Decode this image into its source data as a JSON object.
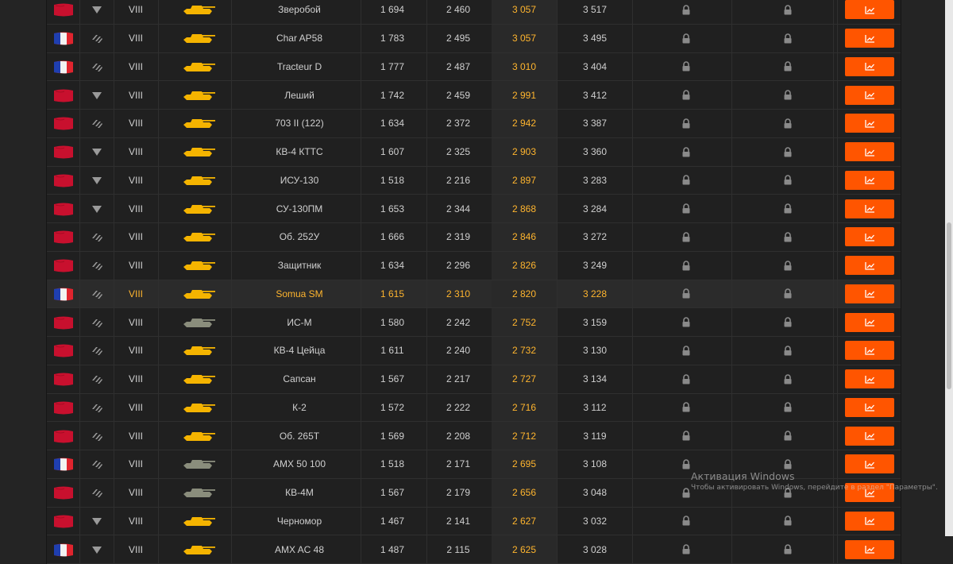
{
  "rows": [
    {
      "nation": "ussr",
      "type": "td",
      "tier": "VIII",
      "name": "Зверобой",
      "v1": "1 694",
      "v2": "2 460",
      "v3": "3 057",
      "v4": "3 517",
      "tank_color": "#f5b400"
    },
    {
      "nation": "france",
      "type": "med",
      "tier": "VIII",
      "name": "Char AP58",
      "v1": "1 783",
      "v2": "2 495",
      "v3": "3 057",
      "v4": "3 495",
      "tank_color": "#f5b400"
    },
    {
      "nation": "france",
      "type": "med",
      "tier": "VIII",
      "name": "Tracteur D",
      "v1": "1 777",
      "v2": "2 487",
      "v3": "3 010",
      "v4": "3 404",
      "tank_color": "#f5b400"
    },
    {
      "nation": "ussr",
      "type": "td",
      "tier": "VIII",
      "name": "Леший",
      "v1": "1 742",
      "v2": "2 459",
      "v3": "2 991",
      "v4": "3 412",
      "tank_color": "#f5b400"
    },
    {
      "nation": "ussr",
      "type": "med",
      "tier": "VIII",
      "name": "703 II (122)",
      "v1": "1 634",
      "v2": "2 372",
      "v3": "2 942",
      "v4": "3 387",
      "tank_color": "#f5b400"
    },
    {
      "nation": "ussr",
      "type": "td",
      "tier": "VIII",
      "name": "КВ-4 КТТС",
      "v1": "1 607",
      "v2": "2 325",
      "v3": "2 903",
      "v4": "3 360",
      "tank_color": "#f5b400"
    },
    {
      "nation": "ussr",
      "type": "td",
      "tier": "VIII",
      "name": "ИСУ-130",
      "v1": "1 518",
      "v2": "2 216",
      "v3": "2 897",
      "v4": "3 283",
      "tank_color": "#f5b400"
    },
    {
      "nation": "ussr",
      "type": "td",
      "tier": "VIII",
      "name": "СУ-130ПМ",
      "v1": "1 653",
      "v2": "2 344",
      "v3": "2 868",
      "v4": "3 284",
      "tank_color": "#f5b400"
    },
    {
      "nation": "ussr",
      "type": "med",
      "tier": "VIII",
      "name": "Об. 252У",
      "v1": "1 666",
      "v2": "2 319",
      "v3": "2 846",
      "v4": "3 272",
      "tank_color": "#f5b400"
    },
    {
      "nation": "ussr",
      "type": "med",
      "tier": "VIII",
      "name": "Защитник",
      "v1": "1 634",
      "v2": "2 296",
      "v3": "2 826",
      "v4": "3 249",
      "tank_color": "#f5b400"
    },
    {
      "nation": "france",
      "type": "med",
      "tier": "VIII",
      "name": "Somua SM",
      "v1": "1 615",
      "v2": "2 310",
      "v3": "2 820",
      "v4": "3 228",
      "tank_color": "#f5b400",
      "highlight": true
    },
    {
      "nation": "ussr",
      "type": "med",
      "tier": "VIII",
      "name": "ИС-М",
      "v1": "1 580",
      "v2": "2 242",
      "v3": "2 752",
      "v4": "3 159",
      "tank_color": "#8a8d7c"
    },
    {
      "nation": "ussr",
      "type": "med",
      "tier": "VIII",
      "name": "КВ-4 Цейца",
      "v1": "1 611",
      "v2": "2 240",
      "v3": "2 732",
      "v4": "3 130",
      "tank_color": "#f5b400"
    },
    {
      "nation": "ussr",
      "type": "med",
      "tier": "VIII",
      "name": "Сапсан",
      "v1": "1 567",
      "v2": "2 217",
      "v3": "2 727",
      "v4": "3 134",
      "tank_color": "#f5b400"
    },
    {
      "nation": "ussr",
      "type": "med",
      "tier": "VIII",
      "name": "К-2",
      "v1": "1 572",
      "v2": "2 222",
      "v3": "2 716",
      "v4": "3 112",
      "tank_color": "#f5b400"
    },
    {
      "nation": "ussr",
      "type": "med",
      "tier": "VIII",
      "name": "Об. 265Т",
      "v1": "1 569",
      "v2": "2 208",
      "v3": "2 712",
      "v4": "3 119",
      "tank_color": "#f5b400"
    },
    {
      "nation": "france",
      "type": "med",
      "tier": "VIII",
      "name": "AMX 50 100",
      "v1": "1 518",
      "v2": "2 171",
      "v3": "2 695",
      "v4": "3 108",
      "tank_color": "#8a8d7c"
    },
    {
      "nation": "ussr",
      "type": "med",
      "tier": "VIII",
      "name": "КВ-4М",
      "v1": "1 567",
      "v2": "2 179",
      "v3": "2 656",
      "v4": "3 048",
      "tank_color": "#8a8d7c"
    },
    {
      "nation": "ussr",
      "type": "td",
      "tier": "VIII",
      "name": "Черномор",
      "v1": "1 467",
      "v2": "2 141",
      "v3": "2 627",
      "v4": "3 032",
      "tank_color": "#f5b400"
    },
    {
      "nation": "france",
      "type": "td",
      "tier": "VIII",
      "name": "AMX AC 48",
      "v1": "1 487",
      "v2": "2 115",
      "v3": "2 625",
      "v4": "3 028",
      "tank_color": "#f5b400"
    }
  ],
  "watermark": {
    "title": "Активация Windows",
    "subtitle": "Чтобы активировать Windows, перейдите в раздел \"Параметры\"."
  },
  "colors": {
    "accent": "#ff5500",
    "highlight_text": "#ffb52e",
    "ussr_flag": "#c8102e",
    "france_blue": "#1f3fb0",
    "france_red": "#e0242e"
  },
  "icons": {
    "td": "td-class-icon",
    "med": "medium-tank-class-icon",
    "lock": "lock-icon",
    "chart": "chart-icon"
  }
}
